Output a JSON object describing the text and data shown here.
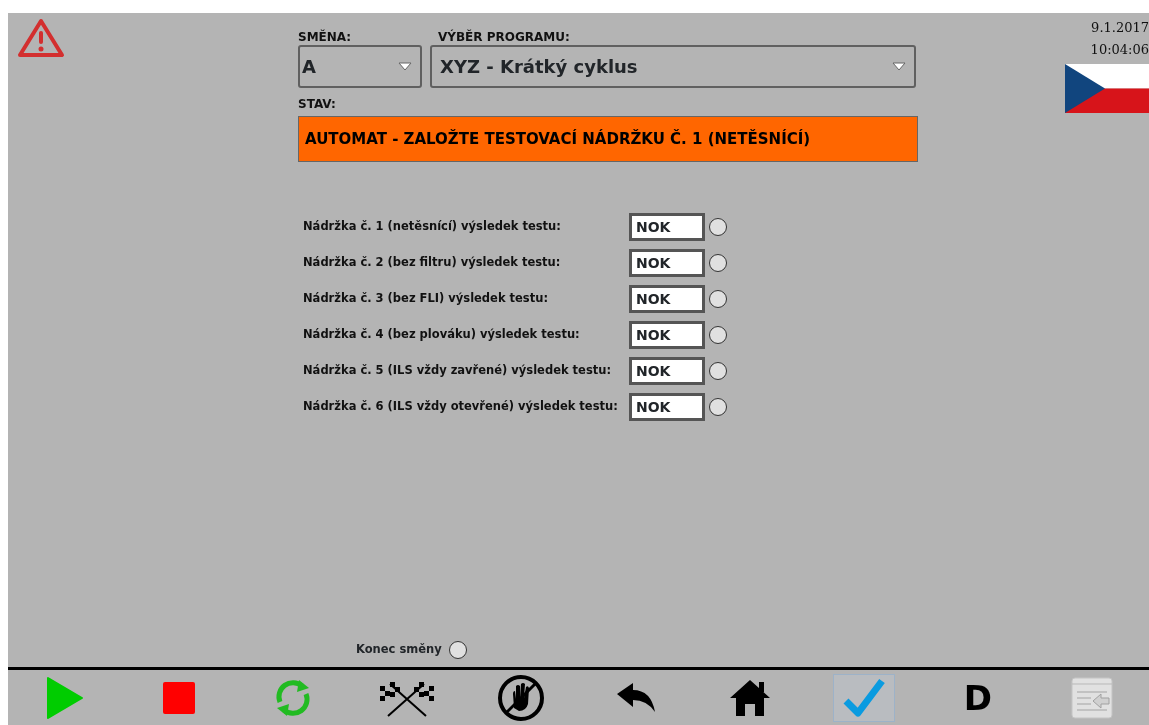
{
  "shift": {
    "label": "SMĚNA:",
    "value": "A"
  },
  "program": {
    "label": "VÝBĚR PROGRAMU:",
    "value": "XYZ - Krátký cyklus"
  },
  "status": {
    "label": "STAV:",
    "text": "AUTOMAT - ZALOŽTE TESTOVACÍ NÁDRŽKU Č. 1 (NETĚSNÍCÍ)",
    "color": "#ff6600"
  },
  "datetime": {
    "date": "9.1.2017",
    "time": "10:04:06"
  },
  "tests": [
    {
      "label": "Nádržka č. 1 (netěsnící) výsledek testu:",
      "result": "NOK",
      "on": false
    },
    {
      "label": "Nádržka č. 2 (bez filtru) výsledek testu:",
      "result": "NOK",
      "on": false
    },
    {
      "label": "Nádržka č. 3 (bez FLI) výsledek testu:",
      "result": "NOK",
      "on": false
    },
    {
      "label": "Nádržka č. 4 (bez plováku) výsledek testu:",
      "result": "NOK",
      "on": false
    },
    {
      "label": "Nádržka č. 5 (ILS vždy zavřené) výsledek testu:",
      "result": "NOK",
      "on": false
    },
    {
      "label": "Nádržka č. 6 (ILS vždy otevřené) výsledek testu:",
      "result": "NOK",
      "on": false
    }
  ],
  "end_of_shift": {
    "label": "Konec směny",
    "on": false
  },
  "toolbar": [
    {
      "kind": "play",
      "selected": false,
      "disabled": false
    },
    {
      "kind": "stop",
      "selected": false,
      "disabled": false
    },
    {
      "kind": "refresh",
      "selected": false,
      "disabled": false
    },
    {
      "kind": "flags",
      "selected": false,
      "disabled": false
    },
    {
      "kind": "nohand",
      "selected": false,
      "disabled": false
    },
    {
      "kind": "back",
      "selected": false,
      "disabled": false
    },
    {
      "kind": "home",
      "selected": false,
      "disabled": false
    },
    {
      "kind": "check",
      "selected": true,
      "disabled": false
    },
    {
      "kind": "text",
      "label": "D",
      "selected": false,
      "disabled": false
    },
    {
      "kind": "exit",
      "selected": false,
      "disabled": true
    }
  ]
}
